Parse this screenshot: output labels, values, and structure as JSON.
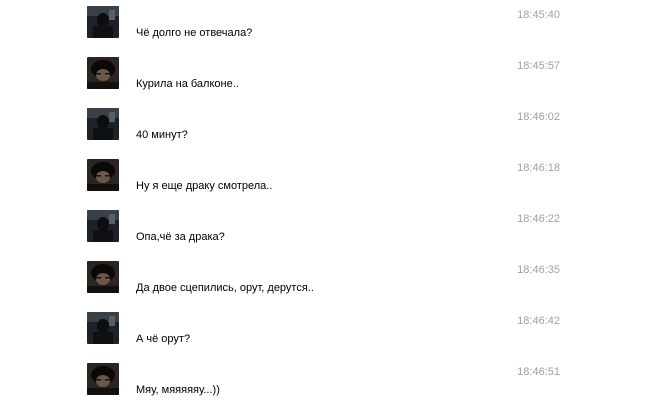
{
  "messages": [
    {
      "avatar": "dark-portrait-avatar-a",
      "text": "Чё долго не отвечала?",
      "time": "18:45:40"
    },
    {
      "avatar": "dark-portrait-avatar-b",
      "text": "Курила на балконе..",
      "time": "18:45:57"
    },
    {
      "avatar": "dark-portrait-avatar-a",
      "text": "40 минут?",
      "time": "18:46:02"
    },
    {
      "avatar": "dark-portrait-avatar-b",
      "text": "Ну я еще драку смотрела..",
      "time": "18:46:18"
    },
    {
      "avatar": "dark-portrait-avatar-a",
      "text": "Опа,чё за драка?",
      "time": "18:46:22"
    },
    {
      "avatar": "dark-portrait-avatar-b",
      "text": "Да двое сцепились, орут, дерутся..",
      "time": "18:46:35"
    },
    {
      "avatar": "dark-portrait-avatar-a",
      "text": "А чё орут?",
      "time": "18:46:42"
    },
    {
      "avatar": "dark-portrait-avatar-b",
      "text": "Мяу, мяяяяяу...))",
      "time": "18:46:51"
    }
  ],
  "colors": {
    "text": "#000000",
    "timestamp": "#a0a0a0",
    "background": "#ffffff"
  }
}
